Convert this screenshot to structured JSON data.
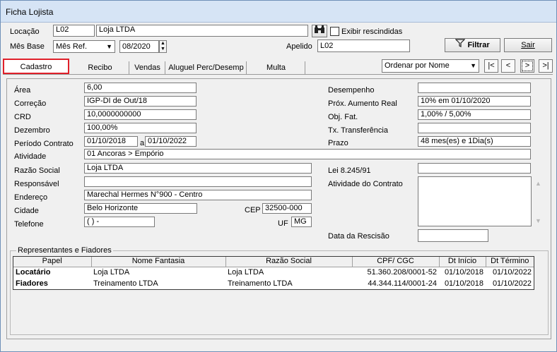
{
  "window": {
    "title": "Ficha Lojista"
  },
  "header": {
    "locacao_label": "Locação",
    "locacao_code": "L02",
    "locacao_name": "Loja LTDA",
    "exibir_label": "Exibir rescindidas",
    "mes_base_label": "Mês Base",
    "mes_base_select": "Mês Ref.",
    "mes_base_value": "08/2020",
    "apelido_label": "Apelido",
    "apelido_value": "L02",
    "filtrar_label": "Filtrar",
    "sair_label": "Sair"
  },
  "tabs": [
    "Cadastro",
    "Recibo",
    "Vendas",
    "Aluguel Perc/Desemp",
    "Multa"
  ],
  "order": {
    "label": "Ordenar por Nome"
  },
  "nav": {
    "first": "|<",
    "prev": "<",
    "next": ">",
    "last": ">|"
  },
  "form": {
    "area_label": "Área",
    "area": "6,00",
    "correcao_label": "Correção",
    "correcao": "IGP-DI de Out/18",
    "crd_label": "CRD",
    "crd": "10,0000000000",
    "dezembro_label": "Dezembro",
    "dezembro": "100,00%",
    "periodo_label": "Período Contrato",
    "periodo_de": "01/10/2018",
    "periodo_sep": "a",
    "periodo_ate": "01/10/2022",
    "atividade_label": "Atividade",
    "atividade": "01 Ancoras > Empório",
    "razao_label": "Razão Social",
    "razao": "Loja LTDA",
    "responsavel_label": "Responsável",
    "responsavel": "",
    "endereco_label": "Endereço",
    "endereco": "Marechal Hermes N°900 - Centro",
    "cidade_label": "Cidade",
    "cidade": "Belo Horizonte",
    "cep_label": "CEP",
    "cep": "32500-000",
    "telefone_label": "Telefone",
    "telefone": "( )  -",
    "uf_label": "UF",
    "uf": "MG",
    "desempenho_label": "Desempenho",
    "desempenho": "",
    "prox_label": "Próx. Aumento Real",
    "prox": "10% em 01/10/2020",
    "obj_label": "Obj. Fat.",
    "obj": "1,00% / 5,00%",
    "tx_label": "Tx. Transferência",
    "tx": "",
    "prazo_label": "Prazo",
    "prazo": "48 mes(es) e 1Dia(s)",
    "lei_label": "Lei 8.245/91",
    "lei": "",
    "ativ_contrato_label": "Atividade do Contrato",
    "data_resc_label": "Data da Rescisão",
    "data_resc": ""
  },
  "representantes": {
    "title": "Representantes e Fiadores",
    "columns": [
      "Papel",
      "Nome Fantasia",
      "Razão Social",
      "CPF/ CGC",
      "Dt Início",
      "Dt Término"
    ],
    "rows": [
      [
        "Locatário",
        "Loja LTDA",
        "Loja LTDA",
        "51.360.208/0001-52",
        "01/10/2018",
        "01/10/2022"
      ],
      [
        "Fiadores",
        "Treinamento LTDA",
        "Treinamento LTDA",
        "44.344.114/0001-24",
        "01/10/2018",
        "01/10/2022"
      ]
    ]
  }
}
